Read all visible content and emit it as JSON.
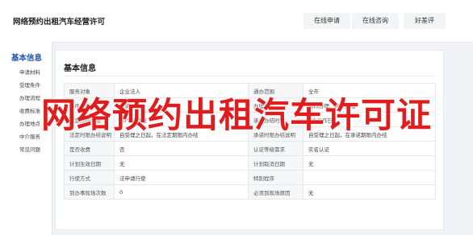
{
  "header": {
    "title": "网络预约出租汽车经营许可",
    "nav": [
      "在线申请",
      "在线咨询",
      "好差评"
    ]
  },
  "sidebar": {
    "title": "基本信息",
    "items": [
      "申请材料",
      "受理条件",
      "办理流程",
      "收费标准",
      "办理地点",
      "中介服务",
      "常见问题"
    ]
  },
  "main": {
    "section_title": "基本信息",
    "rows": [
      [
        "服务对象",
        "企业法人",
        "通办范围",
        "全市"
      ],
      [
        "办件类型",
        "承诺件",
        "办理形式",
        "窗口办理、网上办理"
      ],
      [
        "法定办结时限",
        "20个工作日",
        "承诺办结时限",
        "6个工作日"
      ],
      [
        "法定时限办结说明",
        "自受理之日起，在法定期限内办结",
        "承诺时限办结说明",
        "自受理之日起，在承诺期限内办结"
      ],
      [
        "是否收费",
        "否",
        "认证等级需求",
        "实名认证"
      ],
      [
        "计划生效日期",
        "无",
        "计划取消日期",
        "无"
      ],
      [
        "行使方式",
        "法申请行使",
        "特别程序",
        ""
      ],
      [
        "到办事现场次数",
        "0",
        "必须到现场原因",
        "无"
      ]
    ]
  },
  "overlay": {
    "text": "网络预约出租汽车许可证"
  },
  "colors": {
    "accent": "#2456a8",
    "overlay": "#e01c1c"
  }
}
